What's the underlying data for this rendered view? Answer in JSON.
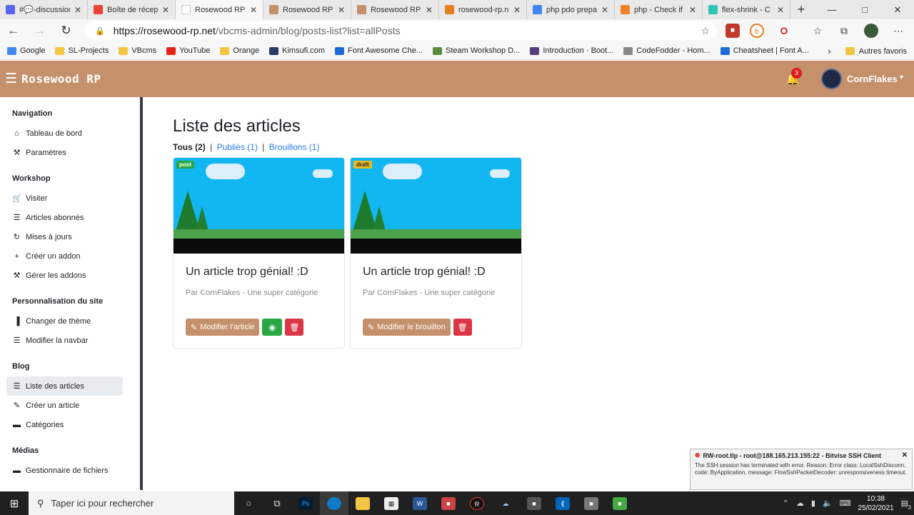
{
  "browser": {
    "tabs": [
      {
        "title": "#💬-discussion",
        "color": "#5865f2"
      },
      {
        "title": "Boîte de récep",
        "color": "#ea4335"
      },
      {
        "title": "Rosewood RP |",
        "color": "#ffffff"
      },
      {
        "title": "Rosewood RP",
        "color": "#c4916c"
      },
      {
        "title": "Rosewood RP",
        "color": "#c4916c"
      },
      {
        "title": "rosewood-rp.n",
        "color": "#e67e22"
      },
      {
        "title": "php pdo prepa",
        "color": "#4285f4"
      },
      {
        "title": "php - Check if",
        "color": "#f48024"
      },
      {
        "title": "flex-shrink - C",
        "color": "#2ec4b6"
      }
    ],
    "new_tab": "+",
    "url_host": "https://rosewood-rp.net",
    "url_path": "/vbcms-admin/blog/posts-list?list=allPosts",
    "bookmarks": [
      {
        "label": "Google",
        "color": "#4285f4"
      },
      {
        "label": "SL-Projects",
        "color": "#f4c542"
      },
      {
        "label": "VBcms",
        "color": "#f4c542"
      },
      {
        "label": "YouTube",
        "color": "#e62117"
      },
      {
        "label": "Orange",
        "color": "#f4c542"
      },
      {
        "label": "Kimsufi.com",
        "color": "#2a3a6a"
      },
      {
        "label": "Font Awesome Che...",
        "color": "#1c6ad6"
      },
      {
        "label": "Steam Workshop D...",
        "color": "#5a8a3a"
      },
      {
        "label": "Introduction · Boot...",
        "color": "#563d7c"
      },
      {
        "label": "CodeFodder - Hom...",
        "color": "#888888"
      },
      {
        "label": "Cheatsheet | Font A...",
        "color": "#1c6ad6"
      }
    ],
    "other_bookmarks": "Autres favoris"
  },
  "app": {
    "brand": "Rosewood RP",
    "notifications": "3",
    "username": "CornFlakes"
  },
  "sidebar": {
    "sections": [
      {
        "title": "Navigation",
        "items": [
          {
            "label": "Tableau de bord",
            "icon": "home-icon"
          },
          {
            "label": "Paramètres",
            "icon": "wrench-icon"
          }
        ]
      },
      {
        "title": "Workshop",
        "items": [
          {
            "label": "Visiter",
            "icon": "cart-icon"
          },
          {
            "label": "Articles abonnés",
            "icon": "list-icon"
          },
          {
            "label": "Mises à jours",
            "icon": "sync-icon"
          },
          {
            "label": "Créer un addon",
            "icon": "plus-icon"
          },
          {
            "label": "Gérer les addons",
            "icon": "wrench-icon"
          }
        ]
      },
      {
        "title": "Personnalisation du site",
        "items": [
          {
            "label": "Changer de thème",
            "icon": "paint-roller-icon"
          },
          {
            "label": "Modifier la navbar",
            "icon": "list-icon"
          }
        ]
      },
      {
        "title": "Blog",
        "items": [
          {
            "label": "Liste des articles",
            "icon": "list-icon",
            "active": true
          },
          {
            "label": "Créer un article",
            "icon": "pen-icon"
          },
          {
            "label": "Catégories",
            "icon": "folder-icon"
          }
        ]
      },
      {
        "title": "Médias",
        "items": [
          {
            "label": "Gestionnaire de fichiers",
            "icon": "folder-icon"
          }
        ]
      }
    ]
  },
  "main": {
    "title": "Liste des articles",
    "filters": {
      "all": "Tous (2)",
      "published": "Publiés (1)",
      "drafts": "Brouillons (1)",
      "separator": "|"
    },
    "cards": [
      {
        "badge": "post",
        "title": "Un article trop génial! :D",
        "meta": "Par CornFlakes - Une super catégorie",
        "edit_label": "Modifier l'article",
        "has_view": true
      },
      {
        "badge": "draft",
        "title": "Un article trop génial! :D",
        "meta": "Par CornFlakes - Une super catégorie",
        "edit_label": "Modifier le brouillon",
        "has_view": false
      }
    ]
  },
  "toast": {
    "title": "RW-root.tlp - root@188.165.213.155:22 - Bitvise SSH Client",
    "body": "The SSH session has terminated with error. Reason: Error class: LocalSshDisconn, code: ByApplication, message: FlowSshPacketDecoder: unresponsiveness timeout."
  },
  "taskbar": {
    "search_placeholder": "Taper ici pour rechercher",
    "time": "10:38",
    "date": "25/02/2021",
    "notif_count": "3"
  }
}
